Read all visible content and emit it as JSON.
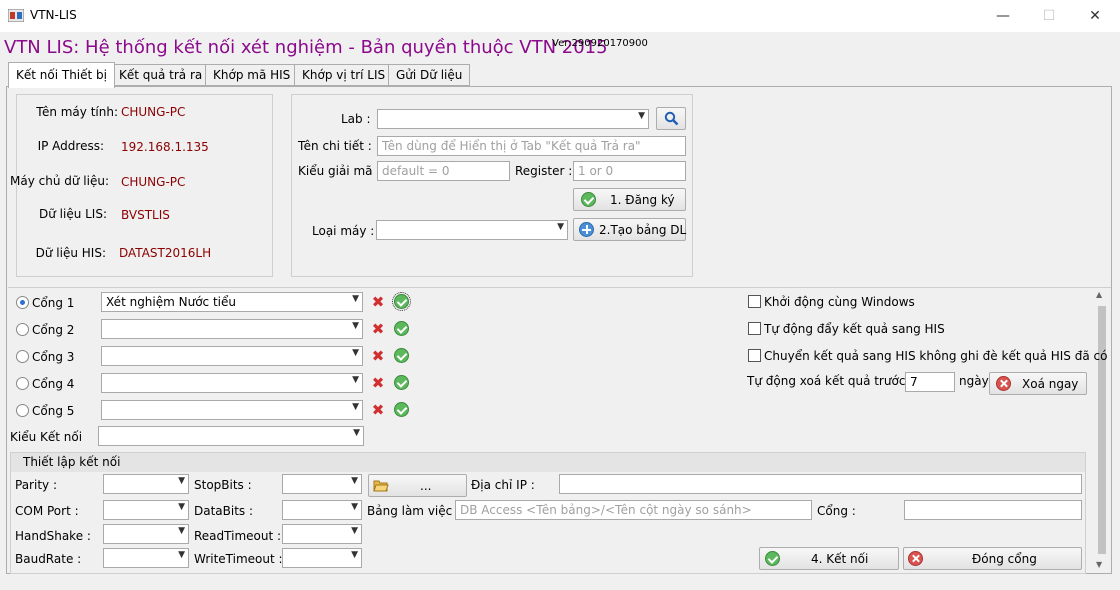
{
  "window": {
    "title": "VTN-LIS",
    "minimize": "—",
    "maximize": "☐",
    "close": "✕"
  },
  "header": {
    "title": "VTN LIS: Hệ thống kết nối xét nghiệm - Bản quyền thuộc VTN 2015",
    "version": "Ver:290920170900"
  },
  "tabs": [
    "Kết nối Thiết bị",
    "Kết quả trả ra",
    "Khớp mã HIS",
    "Khớp vị trí LIS",
    "Gửi Dữ liệu"
  ],
  "machine_info": {
    "computer_label": "Tên máy tính:",
    "computer": "CHUNG-PC",
    "ip_label": "IP Address:",
    "ip": "192.168.1.135",
    "server_label": "Máy chủ dữ liệu:",
    "server": "CHUNG-PC",
    "lis_label": "Dữ liệu LIS:",
    "lis": "BVSTLIS",
    "his_label": "Dữ liệu HIS:",
    "his": "DATAST2016LH"
  },
  "lab_panel": {
    "lab_label": "Lab :",
    "lab_value": "",
    "detail_label": "Tên chi tiết :",
    "detail_placeholder": "Tên dùng để Hiển thị ở Tab \"Kết quả Trả ra\"",
    "decode_label": "Kiểu giải mã :",
    "decode_placeholder": "default = 0",
    "register_label": "Register :",
    "register_placeholder": "1 or 0",
    "register_btn": "1. Đăng ký",
    "machine_type_label": "Loại máy :",
    "machine_type_value": "",
    "create_table_btn": "2.Tạo bảng DL"
  },
  "ports": [
    {
      "label": "Cổng 1",
      "value": "Xét nghiệm Nước tiểu",
      "selected": true
    },
    {
      "label": "Cổng 2",
      "value": "",
      "selected": false
    },
    {
      "label": "Cổng 3",
      "value": "",
      "selected": false
    },
    {
      "label": "Cổng 4",
      "value": "",
      "selected": false
    },
    {
      "label": "Cổng 5",
      "value": "",
      "selected": false
    }
  ],
  "connection_type": {
    "label": "Kiểu Kết nối",
    "value": ""
  },
  "options": {
    "startup_windows": "Khởi động cùng Windows",
    "auto_push_his": "Tự động đẩy kết quả sang HIS",
    "push_no_overwrite": "Chuyển kết quả sang HIS không ghi đè kết quả HIS đã có",
    "auto_delete_label": "Tự động xoá kết quả trước:",
    "auto_delete_days": "7",
    "days_label": "ngày",
    "delete_now_btn": "Xoá ngay"
  },
  "settings": {
    "title": "Thiết lập kết nối",
    "parity": "Parity :",
    "com_port": "COM Port :",
    "handshake": "HandShake :",
    "baudrate": "BaudRate :",
    "stopbits": "StopBits :",
    "databits": "DataBits :",
    "read_timeout": "ReadTimeout :",
    "write_timeout": "WriteTimeout :",
    "browse_btn": "...",
    "ip_label": "Địa chỉ IP :",
    "worktable_label": "Bảng làm việc :",
    "worktable_placeholder": "DB Access <Tên bảng>/<Tên cột ngày so sánh>",
    "port_label": "Cổng :",
    "connect_btn": "4. Kết nối",
    "close_port_btn": "Đóng cổng"
  },
  "colors": {
    "header": "#8b0a8b",
    "value_text": "#8b0000",
    "ok": "#5cb85c",
    "error": "#d9534f"
  }
}
